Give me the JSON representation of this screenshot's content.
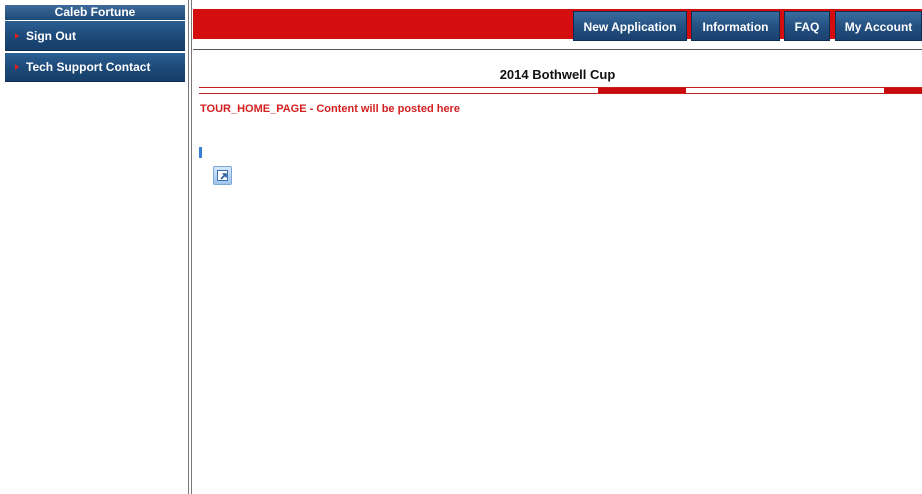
{
  "sidebar": {
    "user_name": "Caleb Fortune",
    "items": [
      {
        "label": "Sign Out",
        "icon": "red-arrow-icon"
      },
      {
        "label": "Tech Support Contact",
        "icon": "red-arrow-icon"
      }
    ]
  },
  "nav": {
    "items": [
      {
        "label": "New Application"
      },
      {
        "label": "Information"
      },
      {
        "label": "FAQ"
      },
      {
        "label": "My Account"
      }
    ]
  },
  "main": {
    "title": "2014 Bothwell Cup",
    "notice": "TOUR_HOME_PAGE - Content will be posted here",
    "link_icon": "external-link-icon"
  },
  "colors": {
    "brand_red": "#d40e0e",
    "nav_blue": "#234f7f",
    "notice_red": "#d42020"
  }
}
